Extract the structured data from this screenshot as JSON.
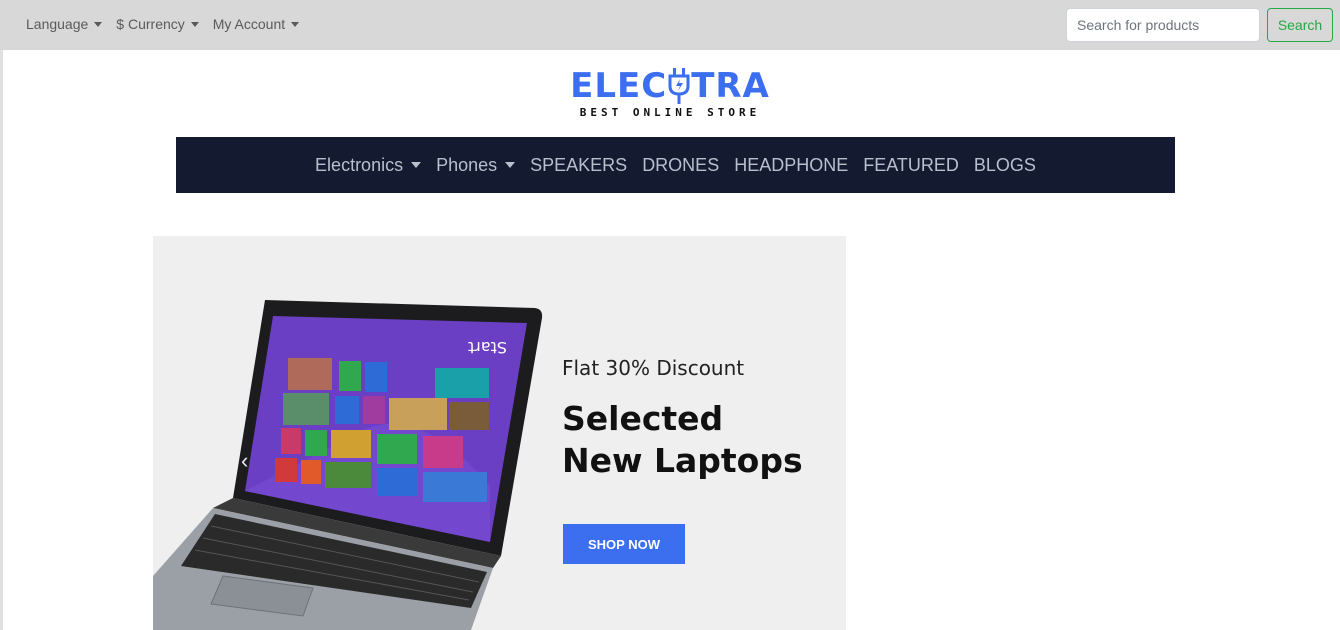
{
  "topbar": {
    "language_label": "Language",
    "currency_label": "$ Currency",
    "account_label": "My Account",
    "search_placeholder": "Search for products",
    "search_button": "Search"
  },
  "logo": {
    "word_left": "ELEC",
    "word_right": "TRA",
    "tagline": "BEST ONLINE STORE"
  },
  "nav": {
    "items": [
      {
        "label": "Electronics",
        "dropdown": true
      },
      {
        "label": "Phones",
        "dropdown": true
      },
      {
        "label": "SPEAKERS"
      },
      {
        "label": "DRONES"
      },
      {
        "label": "HEADPHONE"
      },
      {
        "label": "FEATURED"
      },
      {
        "label": "BLOGS"
      }
    ]
  },
  "banner": {
    "subtitle": "Flat 30% Discount",
    "title_line1": "Selected",
    "title_line2": "New Laptops",
    "button": "SHOP NOW",
    "screen_text": "Start",
    "prev_icon": "‹"
  },
  "colors": {
    "brand": "#3b6ff0",
    "nav_bg": "#141a30",
    "search_btn": "#28a745",
    "topbar_bg": "#d8d8d8"
  }
}
